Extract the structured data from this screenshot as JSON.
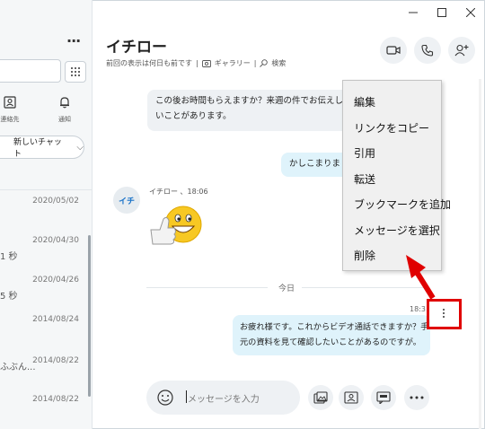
{
  "window": {
    "minimize_icon": "minimize-icon",
    "maximize_icon": "maximize-icon",
    "close_icon": "close-icon"
  },
  "sidebar": {
    "more_label": "···",
    "nav": {
      "contacts_label": "連絡先",
      "notifications_label": "通知"
    },
    "new_chat_label": "新しいチャット",
    "chats": [
      {
        "date": "2020/05/02",
        "snippet": ""
      },
      {
        "date": "2020/04/30",
        "snippet": "1 秒"
      },
      {
        "date": "2020/04/26",
        "snippet": "5 秒"
      },
      {
        "date": "2014/08/24",
        "snippet": ""
      },
      {
        "date": "2014/08/22",
        "snippet": "ふぶん..."
      },
      {
        "date": "2014/08/22",
        "snippet": ""
      }
    ]
  },
  "conversation": {
    "contact_name": "イチロー",
    "last_seen": "前回の表示は何日も前です",
    "gallery_label": "ギャラリー",
    "search_label": "検索",
    "separator": "|",
    "messages": {
      "incoming_1_line1": "この後お時間もらえますか？来週の件でお伝えした",
      "incoming_1_line2": "いことがあります。",
      "outgoing_1": "かしこまりました",
      "sender_meta": "イチロー 、18:06",
      "avatar_initials": "イチ",
      "day_label": "今日",
      "outgoing_time": "18:3",
      "outgoing_2_line1": "お疲れ様です。これからビデオ通話できますか？手",
      "outgoing_2_line2": "元の資料を見て確認したいことがあるのですが。"
    },
    "compose_placeholder": "メッセージを入力"
  },
  "context_menu": {
    "items": [
      "編集",
      "リンクをコピー",
      "引用",
      "転送",
      "ブックマークを追加",
      "メッセージを選択",
      "削除"
    ]
  },
  "colors": {
    "accent": "#1a73c8",
    "annotation": "#e00000",
    "outgoing_bubble": "#dff3fb",
    "incoming_bubble": "#eef1f4"
  }
}
